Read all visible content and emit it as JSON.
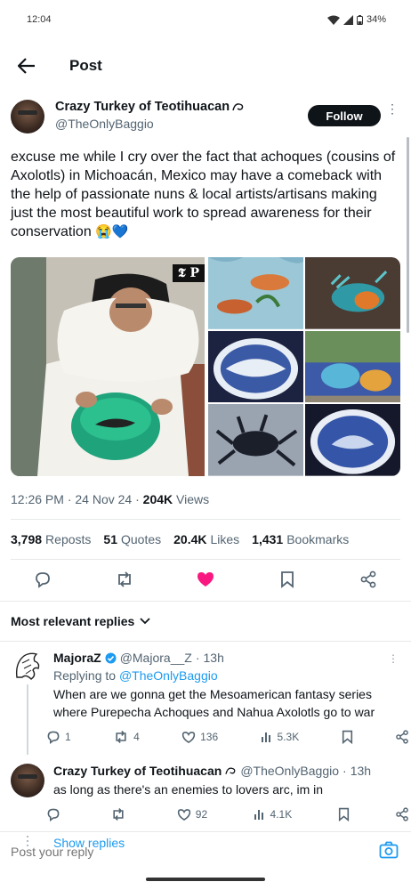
{
  "status_bar": {
    "time": "12:04",
    "battery": "34%"
  },
  "header": {
    "title": "Post"
  },
  "author": {
    "display_name": "Crazy Turkey of Teotihuacan",
    "handle": "@TheOnlyBaggio",
    "follow_label": "Follow"
  },
  "tweet": {
    "text": "excuse me while I cry over the fact that achoques (cousins of Axolotls) in Michoacán, Mexico may have a comeback with the help of passionate nuns & local artists/artisans making just the most beautiful work to spread awareness for their conservation",
    "emoji": "😭💙",
    "media_badge": "𝕿 P",
    "time": "12:26 PM",
    "date": "24 Nov 24",
    "views_count": "204K",
    "views_label": "Views"
  },
  "stats": [
    {
      "count": "3,798",
      "label": "Reposts"
    },
    {
      "count": "51",
      "label": "Quotes"
    },
    {
      "count": "20.4K",
      "label": "Likes"
    },
    {
      "count": "1,431",
      "label": "Bookmarks"
    }
  ],
  "replies_header": {
    "label": "Most relevant replies"
  },
  "replies": [
    {
      "name": "MajoraZ",
      "handle": "@Majora__Z",
      "age": "13h",
      "replying_prefix": "Replying to",
      "replying_to": "@TheOnlyBaggio",
      "text": "When are we gonna get the Mesoamerican fantasy series where Purepecha Achoques and Nahua Axolotls go to war",
      "reply_count": "1",
      "repost_count": "4",
      "like_count": "136",
      "view_count": "5.3K"
    },
    {
      "name": "Crazy Turkey of Teotihuacan",
      "handle": "@TheOnlyBaggio",
      "age": "13h",
      "text": "as long as there's an enemies to lovers arc, im in",
      "reply_count": "",
      "repost_count": "",
      "like_count": "92",
      "view_count": "4.1K"
    }
  ],
  "show_replies": {
    "label": "Show replies"
  },
  "compose": {
    "placeholder": "Post your reply"
  },
  "colors": {
    "accent": "#1d9bf0",
    "like": "#f91880",
    "text": "#0f1419",
    "muted": "#536471"
  }
}
